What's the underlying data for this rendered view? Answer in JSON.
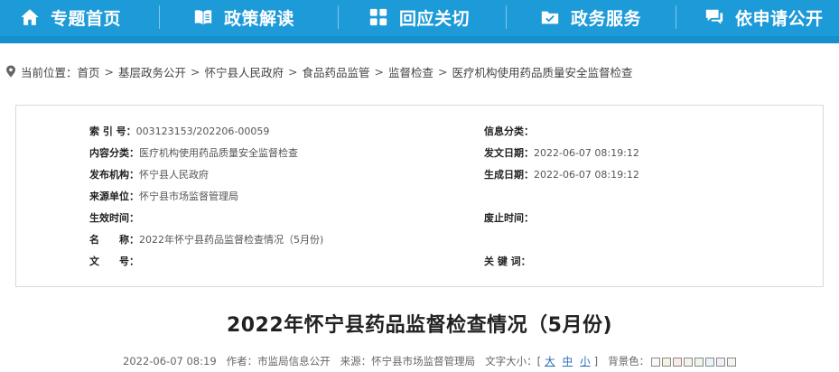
{
  "nav": {
    "items": [
      {
        "label": "专题首页",
        "icon": "home-icon"
      },
      {
        "label": "政策解读",
        "icon": "book-icon"
      },
      {
        "label": "回应关切",
        "icon": "grid-icon"
      },
      {
        "label": "政务服务",
        "icon": "folder-check-icon"
      },
      {
        "label": "依申请公开",
        "icon": "chat-icon"
      }
    ],
    "colors": {
      "bar": "#1d9ad8"
    }
  },
  "breadcrumb": {
    "prefix": "当前位置：",
    "items": [
      "首页",
      "基层政务公开",
      "怀宁县人民政府",
      "食品药品监管",
      "监督检查",
      "医疗机构使用药品质量安全监督检查"
    ],
    "separator": ">"
  },
  "meta": {
    "index_label": "索 引 号：",
    "index_value": "003123153/202206-00059",
    "category_label": "信息分类：",
    "category_value": "",
    "content_label": "内容分类：",
    "content_value": "医疗机构使用药品质量安全监督检查",
    "issue_date_label": "发文日期：",
    "issue_date_value": "2022-06-07 08:19:12",
    "publisher_label": "发布机构：",
    "publisher_value": "怀宁县人民政府",
    "gen_date_label": "生成日期：",
    "gen_date_value": "2022-06-07 08:19:12",
    "source_label": "来源单位：",
    "source_value": "怀宁县市场监督管理局",
    "effective_label": "生效时间：",
    "effective_value": "",
    "repeal_label": "废止时间：",
    "repeal_value": "",
    "name_label": "名　　称：",
    "name_value": "2022年怀宁县药品监督检查情况（5月份)",
    "doc_no_label": "文　　号：",
    "doc_no_value": "",
    "keywords_label": "关 键 词：",
    "keywords_value": ""
  },
  "article": {
    "title": "2022年怀宁县药品监督检查情况（5月份)",
    "date": "2022-06-07 08:19",
    "author": "作者：市监局信息公开",
    "source": "来源：怀宁县市场监督管理局",
    "font_size_label": "文字大小：[",
    "font_large": "大",
    "font_medium": "中",
    "font_small": "小",
    "font_size_end": "]",
    "bg_label": "背景色：",
    "bg_colors": [
      "#f9f9f9",
      "#f7f1e1",
      "#fae9e7",
      "#f2f5e5",
      "#eaf7ea",
      "#e9f3fb",
      "#f2eef8",
      "#f4f4f4"
    ]
  }
}
